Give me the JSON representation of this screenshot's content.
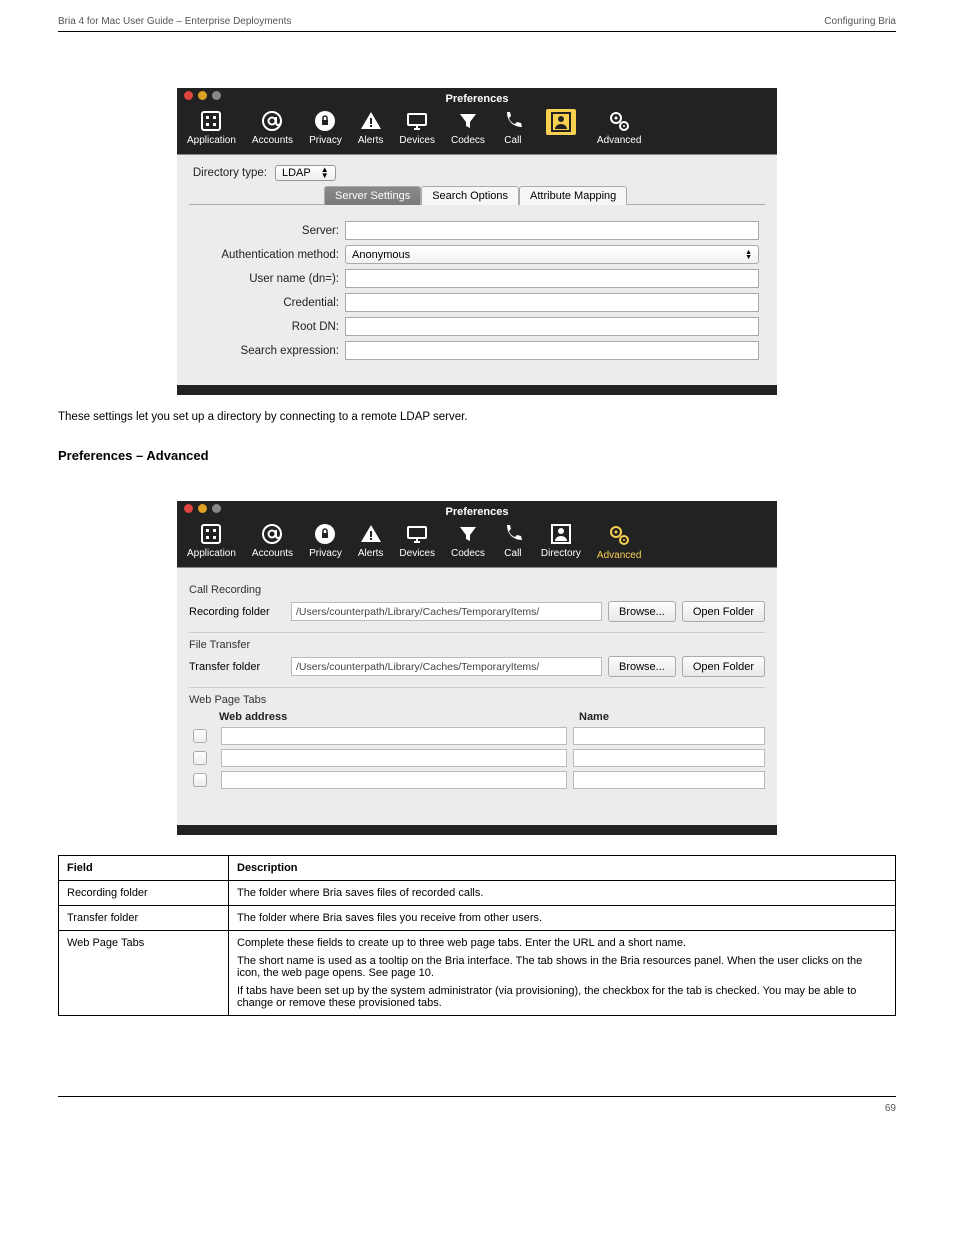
{
  "header": {
    "left": "Bria 4 for Mac User Guide – Enterprise Deployments",
    "right": "Configuring Bria"
  },
  "window_title": "Preferences",
  "toolbar_items": [
    {
      "label": "Application"
    },
    {
      "label": "Accounts"
    },
    {
      "label": "Privacy"
    },
    {
      "label": "Alerts"
    },
    {
      "label": "Devices"
    },
    {
      "label": "Codecs"
    },
    {
      "label": "Call"
    },
    {
      "label": "Directory"
    },
    {
      "label": "Advanced"
    }
  ],
  "dir": {
    "type_label": "Directory type:",
    "type_value": "LDAP",
    "tabs": [
      "Server Settings",
      "Search Options",
      "Attribute Mapping"
    ],
    "fields": {
      "server": "Server:",
      "auth": "Authentication method:",
      "auth_value": "Anonymous",
      "user": "User name (dn=):",
      "cred": "Credential:",
      "root": "Root DN:",
      "search": "Search expression:"
    }
  },
  "after_dir_text": "These settings let you set up a directory by connecting to a remote LDAP server.",
  "heading_adv": "Preferences – Advanced",
  "adv": {
    "call_rec": "Call Recording",
    "rec_folder_lbl": "Recording folder",
    "rec_path": "/Users/counterpath/Library/Caches/TemporaryItems/",
    "file_xfer": "File Transfer",
    "xfer_folder_lbl": "Transfer folder",
    "xfer_path": "/Users/counterpath/Library/Caches/TemporaryItems/",
    "browse": "Browse...",
    "open": "Open Folder",
    "web_tabs": "Web Page Tabs",
    "web_addr": "Web address",
    "name": "Name"
  },
  "table": {
    "h1": "Field",
    "h2": "Description",
    "r1c1": "Recording folder",
    "r1c2": "The folder where Bria saves files of recorded calls.",
    "r2c1": "Transfer folder",
    "r2c2": "The folder where Bria saves files you receive from other users.",
    "r3c1": "Web Page Tabs",
    "r3c2a": "Complete these fields to create up to three web page tabs. Enter the URL and a short name.",
    "r3c2b": "The short name is used as a tooltip on the Bria interface. The tab shows in the Bria resources panel. When the user clicks on the icon, the web page opens. See page 10.",
    "r3c2c": "If tabs have been set up by the system administrator (via provisioning), the checkbox for the tab is checked. You may be able to change or remove these provisioned tabs."
  },
  "footer": {
    "page": "69"
  }
}
